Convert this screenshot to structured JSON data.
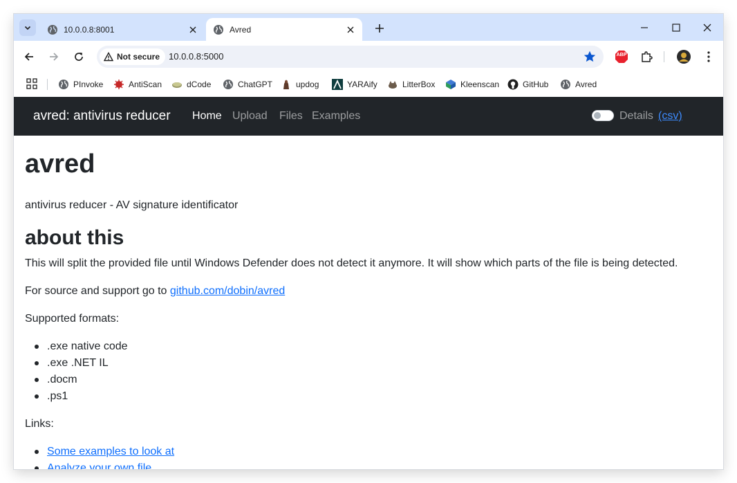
{
  "browser": {
    "tabs": [
      {
        "title": "10.0.0.8:8001",
        "active": false
      },
      {
        "title": "Avred",
        "active": true
      }
    ],
    "security_label": "Not secure",
    "url": "10.0.0.8:5000",
    "bookmarks": [
      {
        "label": "PInvoke",
        "icon": "globe-icon"
      },
      {
        "label": "AntiScan",
        "icon": "antiscan-icon"
      },
      {
        "label": "dCode",
        "icon": "dcode-icon"
      },
      {
        "label": "ChatGPT",
        "icon": "globe-icon"
      },
      {
        "label": "updog",
        "icon": "updog-icon"
      },
      {
        "label": "YARAify",
        "icon": "yaraify-icon"
      },
      {
        "label": "LitterBox",
        "icon": "litterbox-icon"
      },
      {
        "label": "Kleenscan",
        "icon": "kleenscan-icon"
      },
      {
        "label": "GitHub",
        "icon": "github-icon"
      },
      {
        "label": "Avred",
        "icon": "globe-icon"
      }
    ],
    "extension_badge": "ABP"
  },
  "navbar": {
    "brand": "avred: antivirus reducer",
    "links": [
      {
        "label": "Home",
        "active": true
      },
      {
        "label": "Upload",
        "active": false
      },
      {
        "label": "Files",
        "active": false
      },
      {
        "label": "Examples",
        "active": false
      }
    ],
    "details_label": "Details",
    "csv_label": "(csv)",
    "details_toggle_on": false
  },
  "main": {
    "title": "avred",
    "subtitle": "antivirus reducer - AV signature identificator",
    "about_heading": "about this",
    "about_text": "This will split the provided file until Windows Defender does not detect it anymore. It will show which parts of the file is being detected.",
    "source_prefix": "For source and support go to ",
    "source_link": "github.com/dobin/avred",
    "formats_label": "Supported formats:",
    "formats": [
      ".exe native code",
      ".exe .NET IL",
      ".docm",
      ".ps1"
    ],
    "links_label": "Links:",
    "links": [
      "Some examples to look at",
      "Analyze your own file"
    ]
  },
  "colors": {
    "tabstrip_bg": "#d3e3fd",
    "navbar_bg": "#212529",
    "link": "#0d6efd",
    "star": "#0b57d0"
  }
}
